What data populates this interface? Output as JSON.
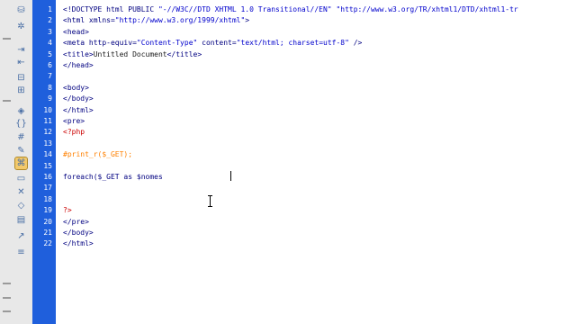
{
  "toolbar": {
    "icons": [
      {
        "name": "open-documents-icon",
        "glyph": "⛁",
        "active": false
      },
      {
        "name": "settings-icon",
        "glyph": "✲",
        "active": false
      },
      {
        "name": "indent-icon",
        "glyph": "⇥",
        "active": false
      },
      {
        "name": "outdent-icon",
        "glyph": "⇤",
        "active": false
      },
      {
        "name": "collapse-icon",
        "glyph": "⊟",
        "active": false
      },
      {
        "name": "expand-icon",
        "glyph": "⊞",
        "active": false
      },
      {
        "name": "select-parent-tag-icon",
        "glyph": "◈",
        "active": false
      },
      {
        "name": "balance-braces-icon",
        "glyph": "{}",
        "active": false
      },
      {
        "name": "line-numbers-icon",
        "glyph": "#",
        "active": false
      },
      {
        "name": "highlight-invalid-code-icon",
        "glyph": "✎",
        "active": false
      },
      {
        "name": "syntax-coloring-icon",
        "glyph": "⌘",
        "active": true
      },
      {
        "name": "apply-comment-icon",
        "glyph": "▭",
        "active": false
      },
      {
        "name": "remove-comment-icon",
        "glyph": "✕",
        "active": false
      },
      {
        "name": "wrap-tag-icon",
        "glyph": "◇",
        "active": false
      },
      {
        "name": "recent-snippets-icon",
        "glyph": "▤",
        "active": false
      },
      {
        "name": "move-css-icon",
        "glyph": "↗",
        "active": false
      },
      {
        "name": "format-source-icon",
        "glyph": "≡",
        "active": false
      }
    ]
  },
  "editor": {
    "lines": [
      {
        "n": "1",
        "segs": [
          {
            "c": "tag",
            "t": "<!DOCTYPE html PUBLIC "
          },
          {
            "c": "str",
            "t": "\"-//W3C//DTD XHTML 1.0 Transitional//EN\" \"http://www.w3.org/TR/xhtml1/DTD/xhtml1-tr"
          }
        ]
      },
      {
        "n": "2",
        "segs": [
          {
            "c": "tag",
            "t": "<html xmlns="
          },
          {
            "c": "str",
            "t": "\"http://www.w3.org/1999/xhtml\""
          },
          {
            "c": "tag",
            "t": ">"
          }
        ]
      },
      {
        "n": "3",
        "segs": [
          {
            "c": "tag",
            "t": "<head>"
          }
        ]
      },
      {
        "n": "4",
        "segs": [
          {
            "c": "tag",
            "t": "<meta http-equiv="
          },
          {
            "c": "str",
            "t": "\"Content-Type\""
          },
          {
            "c": "tag",
            "t": " content="
          },
          {
            "c": "str",
            "t": "\"text/html; charset=utf-8\""
          },
          {
            "c": "tag",
            "t": " />"
          }
        ]
      },
      {
        "n": "5",
        "segs": [
          {
            "c": "tag",
            "t": "<title>"
          },
          {
            "c": "plain",
            "t": "Untitled Document"
          },
          {
            "c": "tag",
            "t": "</title>"
          }
        ]
      },
      {
        "n": "6",
        "segs": [
          {
            "c": "tag",
            "t": "</head>"
          }
        ]
      },
      {
        "n": "7",
        "segs": []
      },
      {
        "n": "8",
        "segs": [
          {
            "c": "tag",
            "t": "<body>"
          }
        ]
      },
      {
        "n": "9",
        "segs": [
          {
            "c": "tag",
            "t": "</body>"
          }
        ]
      },
      {
        "n": "10",
        "segs": [
          {
            "c": "tag",
            "t": "</html>"
          }
        ]
      },
      {
        "n": "11",
        "segs": [
          {
            "c": "tag",
            "t": "<pre>"
          }
        ]
      },
      {
        "n": "12",
        "segs": [
          {
            "c": "php",
            "t": "<?php"
          }
        ]
      },
      {
        "n": "13",
        "segs": []
      },
      {
        "n": "14",
        "segs": [
          {
            "c": "cmt",
            "t": "#print_r($_GET);"
          }
        ]
      },
      {
        "n": "15",
        "segs": []
      },
      {
        "n": "16",
        "segs": [
          {
            "c": "var",
            "t": "foreach($_GET as $nomes"
          }
        ]
      },
      {
        "n": "17",
        "segs": []
      },
      {
        "n": "18",
        "segs": []
      },
      {
        "n": "19",
        "segs": [
          {
            "c": "php",
            "t": "?>"
          }
        ]
      },
      {
        "n": "20",
        "segs": [
          {
            "c": "tag",
            "t": "</pre>"
          }
        ]
      },
      {
        "n": "21",
        "segs": [
          {
            "c": "tag",
            "t": "</body>"
          }
        ]
      },
      {
        "n": "22",
        "segs": [
          {
            "c": "tag",
            "t": "</html>"
          }
        ]
      }
    ]
  }
}
